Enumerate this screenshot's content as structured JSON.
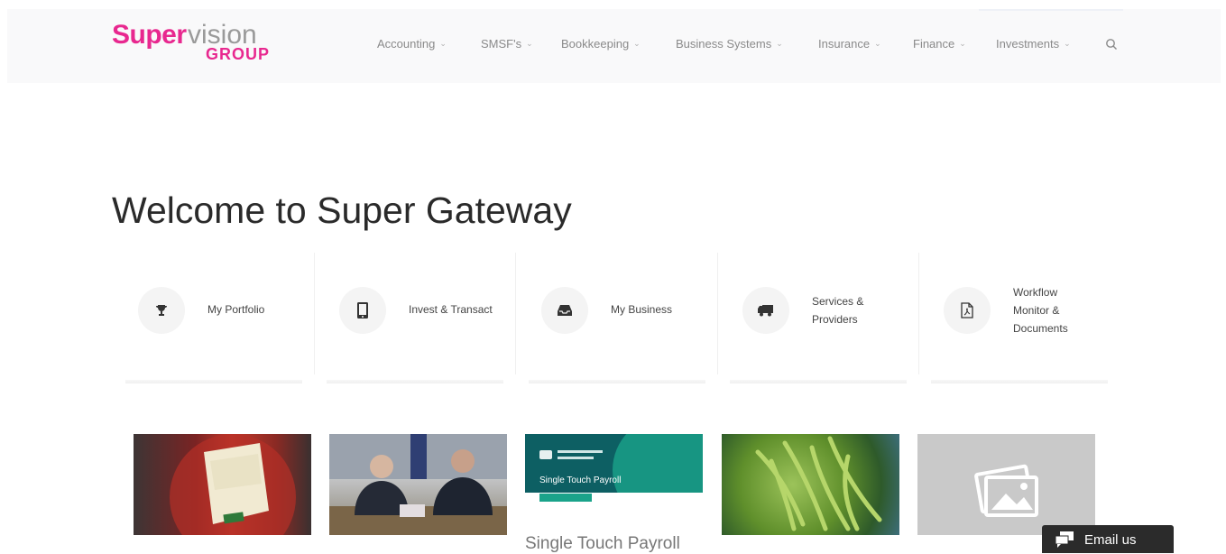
{
  "brand": {
    "logo_super": "Super",
    "logo_vision": "vision",
    "logo_group": "GROUP",
    "primary_color": "#e8288f"
  },
  "nav": {
    "items": [
      {
        "label": "Accounting"
      },
      {
        "label": "SMSF's"
      },
      {
        "label": "Bookkeeping"
      },
      {
        "label": "Business Systems"
      },
      {
        "label": "Insurance"
      },
      {
        "label": "Finance"
      },
      {
        "label": "Investments"
      }
    ],
    "chevron": "⌄",
    "search_icon": "search-icon"
  },
  "hero": {
    "title": "Welcome to Super Gateway"
  },
  "tiles": [
    {
      "label": "My Portfolio",
      "icon": "trophy-icon"
    },
    {
      "label": "Invest & Transact",
      "icon": "tablet-icon"
    },
    {
      "label": "My Business",
      "icon": "inbox-icon"
    },
    {
      "label": "Services & Providers",
      "label_lines": [
        "Services &",
        "Providers"
      ],
      "icon": "truck-icon"
    },
    {
      "label": "Workflow Monitor & Documents",
      "label_lines": [
        "Workflow",
        "Monitor &",
        "Documents"
      ],
      "icon": "pdf-file-icon"
    }
  ],
  "cards": {
    "stp_heading": "Single Touch Payroll",
    "stp_caption": "Single Touch Payroll",
    "placeholder_icon": "image-icon"
  },
  "email": {
    "label": "Email us",
    "icon": "chat-icon"
  }
}
